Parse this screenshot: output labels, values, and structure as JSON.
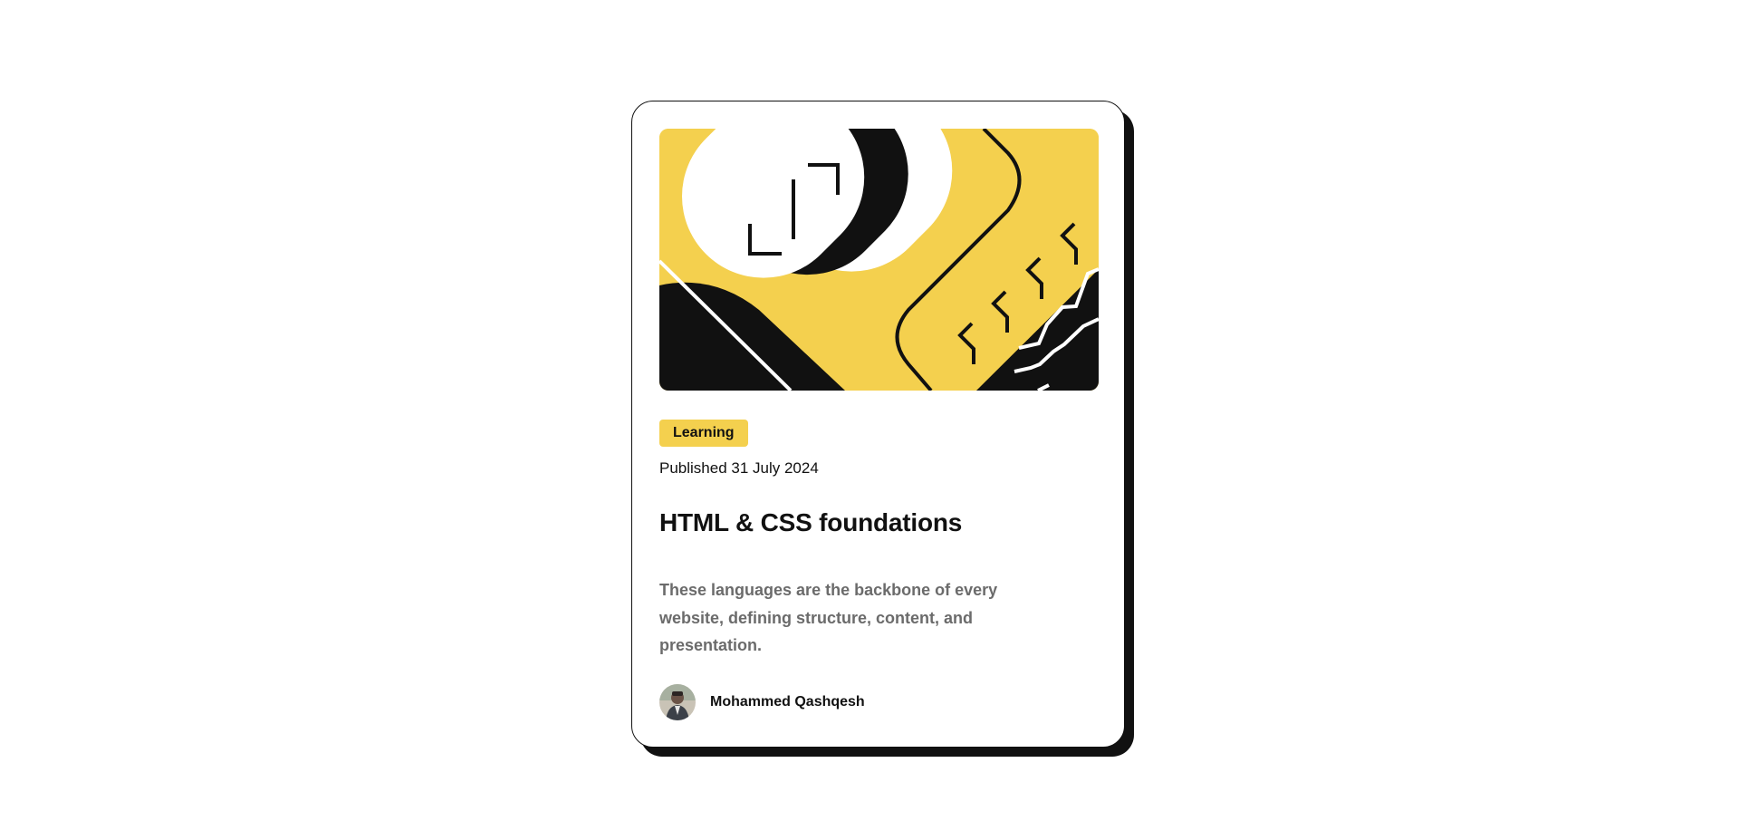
{
  "card": {
    "tag": "Learning",
    "published": "Published 31 July 2024",
    "title": "HTML & CSS foundations",
    "description": "These languages are the backbone of every website, defining structure, content, and presentation.",
    "author": {
      "name": "Mohammed Qashqesh"
    }
  },
  "colors": {
    "accent_yellow": "#f4d04e",
    "ink": "#111111",
    "muted_text": "#6b6b6b",
    "background": "#ffffff"
  },
  "icons": {
    "hero": "abstract-illustration",
    "avatar": "author-photo"
  }
}
